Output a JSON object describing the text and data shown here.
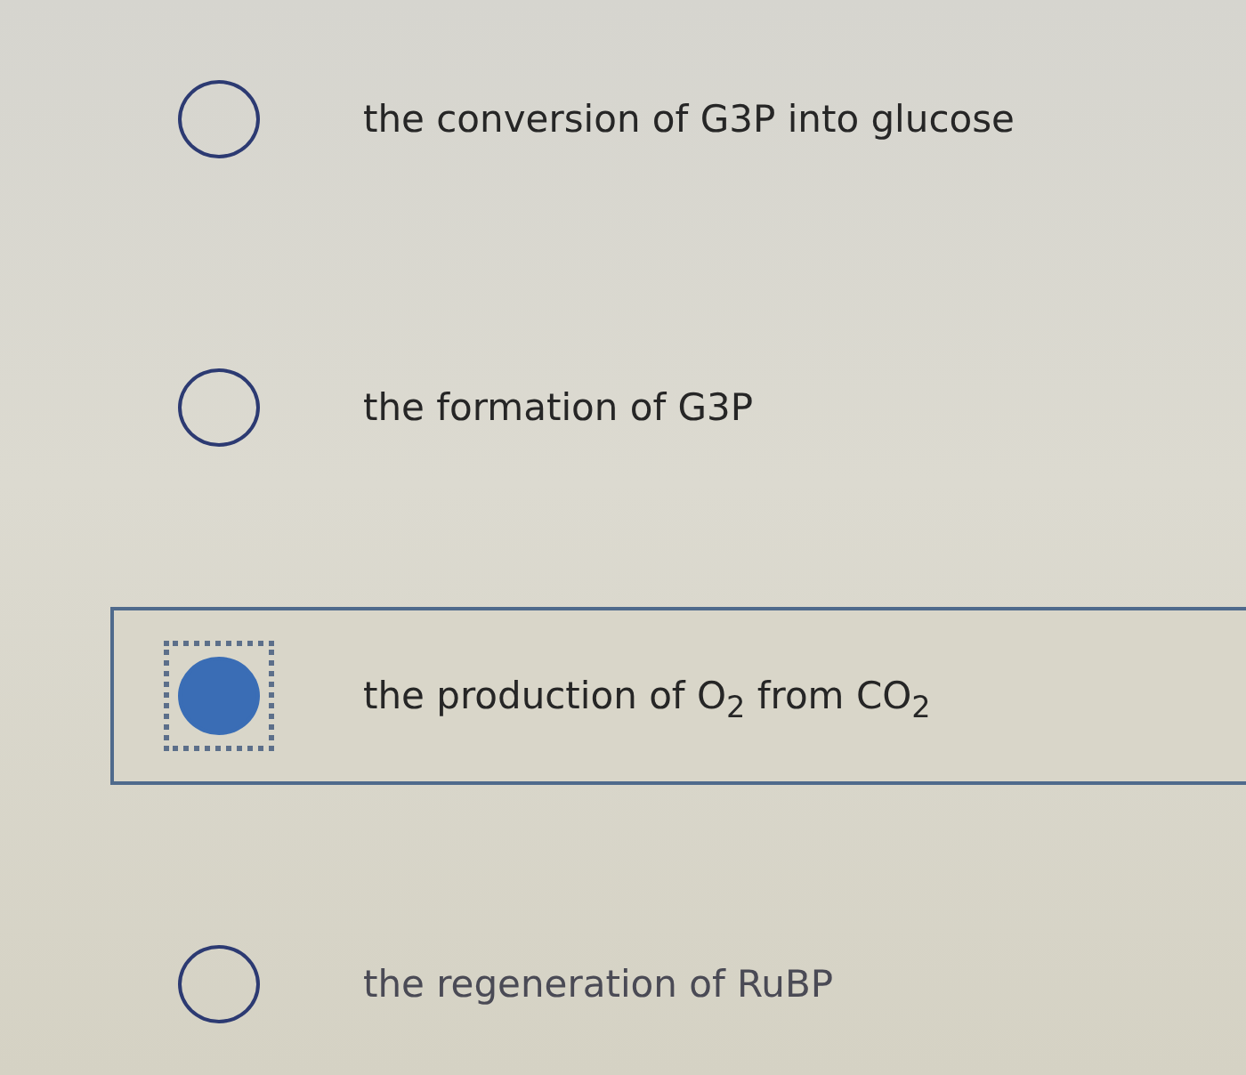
{
  "options": [
    {
      "text": "the conversion of G3P into glucose",
      "selected": false
    },
    {
      "text": "the formation of G3P",
      "selected": false
    },
    {
      "text": "the production of O$_{2}$ from CO$_{2}$",
      "selected": true
    },
    {
      "text": "the regeneration of RuBP",
      "selected": false
    }
  ]
}
